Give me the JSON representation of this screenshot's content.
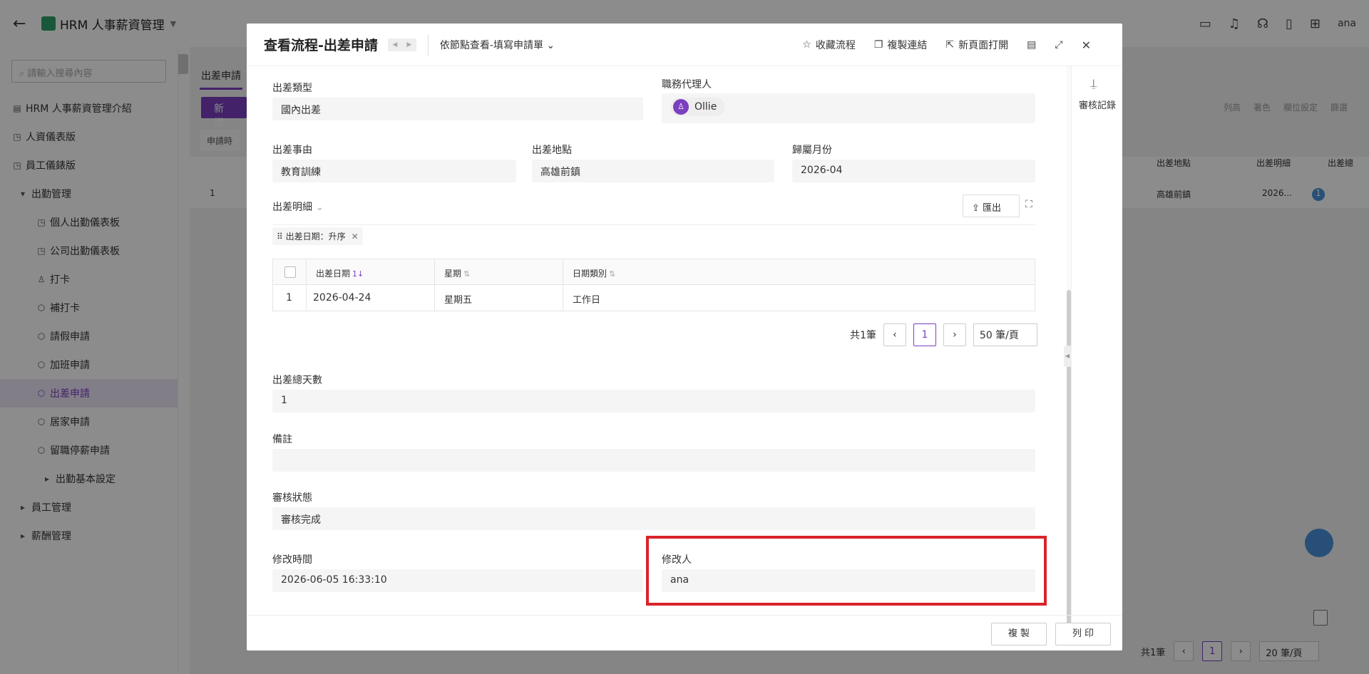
{
  "app": {
    "title": "HRM 人事薪資管理",
    "user": "ana"
  },
  "sidebar": {
    "search_placeholder": "請輸入搜尋內容",
    "items": [
      {
        "label": "HRM 人事薪資管理介紹"
      },
      {
        "label": "人資儀表版"
      },
      {
        "label": "員工儀錶版"
      },
      {
        "label": "出勤管理"
      },
      {
        "label": "個人出勤儀表板"
      },
      {
        "label": "公司出勤儀表板"
      },
      {
        "label": "打卡"
      },
      {
        "label": "補打卡"
      },
      {
        "label": "請假申請"
      },
      {
        "label": "加班申請"
      },
      {
        "label": "出差申請"
      },
      {
        "label": "居家申請"
      },
      {
        "label": "留職停薪申請"
      },
      {
        "label": "出勤基本設定"
      },
      {
        "label": "員工管理"
      },
      {
        "label": "薪酬管理"
      }
    ]
  },
  "background": {
    "tab": "出差申請",
    "add_button": "新 增",
    "toolbar": [
      "列高",
      "著色",
      "欄位設定",
      "篩選"
    ],
    "filter_chip": "申請時",
    "columns": [
      "出差地點",
      "出差明細",
      "出差總"
    ],
    "row": {
      "index": "1",
      "location": "高雄前鎮",
      "detail": "2026...",
      "badge": "1"
    },
    "footer": {
      "total": "共1筆",
      "page": "1",
      "page_size": "20 筆/頁"
    }
  },
  "modal": {
    "title": "查看流程-出差申請",
    "view_mode": "依節點查看-填寫申請單",
    "actions": {
      "favorite": "收藏流程",
      "copy_link": "複製連結",
      "open_new": "新頁面打開"
    },
    "right_panel": {
      "label": "審核記錄"
    },
    "fields": {
      "trip_type": {
        "label": "出差類型",
        "value": "國內出差"
      },
      "agent": {
        "label": "職務代理人",
        "value": "Ollie"
      },
      "reason": {
        "label": "出差事由",
        "value": "教育訓練"
      },
      "location": {
        "label": "出差地點",
        "value": "高雄前鎮"
      },
      "month": {
        "label": "歸屬月份",
        "value": "2026-04"
      },
      "total_days": {
        "label": "出差總天數",
        "value": "1"
      },
      "remark": {
        "label": "備註",
        "value": ""
      },
      "status": {
        "label": "審核狀態",
        "value": "審核完成"
      },
      "modified_time": {
        "label": "修改時間",
        "value": "2026-06-05 16:33:10"
      },
      "modified_by": {
        "label": "修改人",
        "value": "ana"
      }
    },
    "detail_table": {
      "title": "出差明細",
      "export": "匯出",
      "sort_tag": "出差日期：升序",
      "columns": [
        "出差日期",
        "星期",
        "日期類別"
      ],
      "rows": [
        {
          "index": "1",
          "date": "2026-04-24",
          "weekday": "星期五",
          "type": "工作日"
        }
      ],
      "total": "共1筆",
      "page": "1",
      "page_size": "50 筆/頁"
    },
    "footer": {
      "copy": "複 製",
      "print": "列 印"
    }
  }
}
